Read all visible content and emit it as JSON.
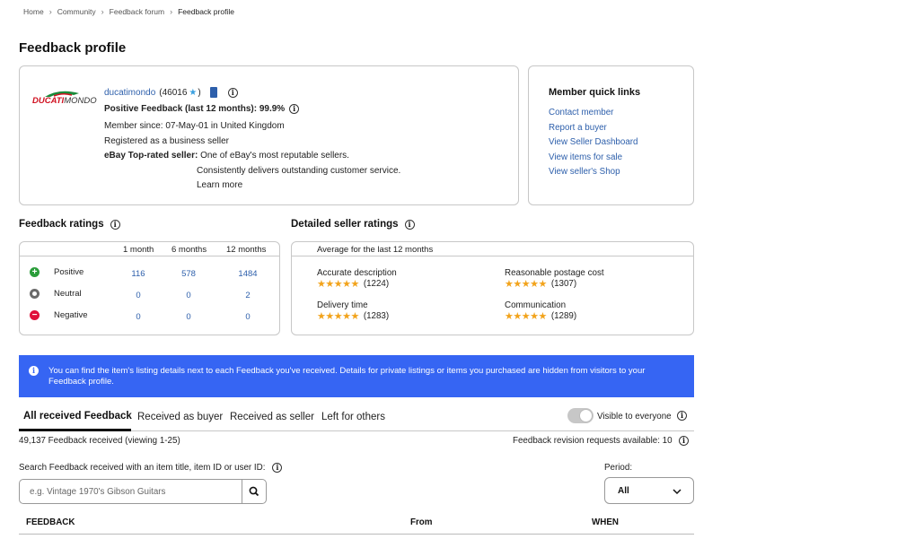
{
  "breadcrumb": [
    "Home",
    "Community",
    "Feedback forum",
    "Feedback profile"
  ],
  "page_title": "Feedback profile",
  "profile": {
    "logo_text_1": "DUCATI",
    "logo_text_2": "MONDO",
    "username": "ducatimondo",
    "score": "(46016",
    "score_close": ")",
    "positive_feedback": "Positive Feedback (last 12 months): 99.9%",
    "member_since": "Member since: 07-May-01 in United Kingdom",
    "registered": "Registered as a business seller",
    "top_rated_label": "eBay Top-rated seller:",
    "top_rated_text": "One of eBay's most reputable sellers.",
    "top_rated_text_2": "Consistently delivers outstanding customer service.",
    "learn_more": "Learn more"
  },
  "quick_links": {
    "title": "Member quick links",
    "items": [
      "Contact member",
      "Report a buyer",
      "View Seller Dashboard",
      "View items for sale",
      "View seller's Shop"
    ]
  },
  "feedback_ratings": {
    "title": "Feedback ratings",
    "columns": [
      "1 month",
      "6 months",
      "12 months"
    ],
    "rows": [
      {
        "label": "Positive",
        "values": [
          "116",
          "578",
          "1484"
        ],
        "color": "#2a9d3a"
      },
      {
        "label": "Neutral",
        "values": [
          "0",
          "0",
          "2"
        ],
        "color": "#6b6b6b"
      },
      {
        "label": "Negative",
        "values": [
          "0",
          "0",
          "0"
        ],
        "color": "#e0103a"
      }
    ]
  },
  "detailed_ratings": {
    "title": "Detailed seller ratings",
    "subtitle": "Average for the last 12 months",
    "items": [
      {
        "label": "Accurate description",
        "count": "(1224)",
        "stars": "★★★★★"
      },
      {
        "label": "Reasonable postage cost",
        "count": "(1307)",
        "stars": "★★★★★"
      },
      {
        "label": "Delivery time",
        "count": "(1283)",
        "stars": "★★★★★"
      },
      {
        "label": "Communication",
        "count": "(1289)",
        "stars": "★★★★★"
      }
    ]
  },
  "banner": {
    "text": "You can find the item's listing details next to each Feedback you've received. Details for private listings or items you purchased are hidden from visitors to your Feedback profile."
  },
  "tabs": [
    "All received Feedback",
    "Received as buyer",
    "Received as seller",
    "Left for others"
  ],
  "visible_label": "Visible to everyone",
  "received_count": "49,137 Feedback received (viewing 1-25)",
  "revision_requests": "Feedback revision requests available: 10",
  "search": {
    "label": "Search Feedback received with an item title, item ID or user ID:",
    "placeholder": "e.g. Vintage 1970's Gibson Guitars"
  },
  "period": {
    "label": "Period:",
    "value": "All"
  },
  "table_headers": {
    "feedback": "FEEDBACK",
    "from": "From",
    "when": "WHEN"
  },
  "colors": {
    "link": "#2d5fab",
    "banner": "#3665f3",
    "star": "#f2a31b"
  }
}
